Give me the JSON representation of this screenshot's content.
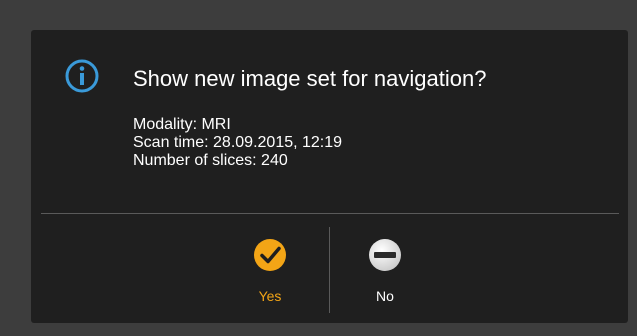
{
  "dialog": {
    "title": "Show new image set for navigation?",
    "icon": "info-icon",
    "details": [
      "Modality: MRI",
      "Scan time: 28.09.2015, 12:19",
      "Number of slices: 240"
    ],
    "buttons": {
      "yes": {
        "label": "Yes",
        "icon": "checkmark-icon",
        "color": "#f3a516"
      },
      "no": {
        "label": "No",
        "icon": "minus-icon",
        "color": "#ffffff"
      }
    }
  },
  "colors": {
    "background": "#3d3d3d",
    "dialog_background": "#1f1f1f",
    "info_accent": "#3a9ad9",
    "yes_accent": "#f3a516"
  }
}
